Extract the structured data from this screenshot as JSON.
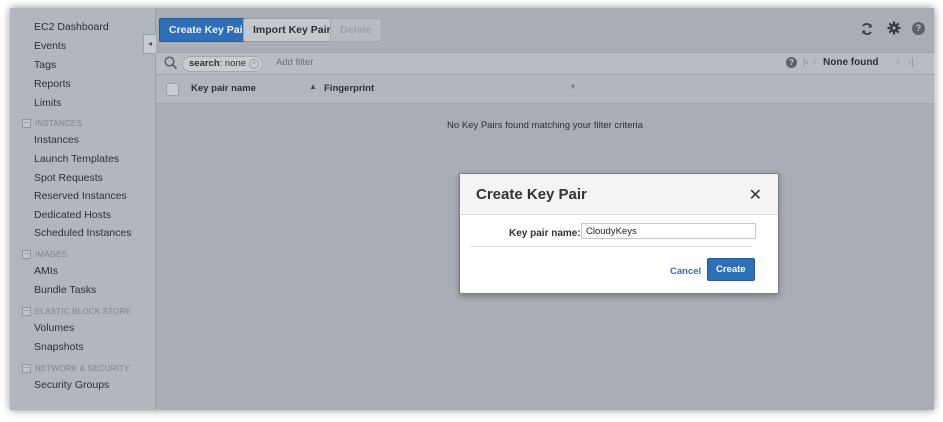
{
  "sidebar": {
    "items": [
      {
        "label": "EC2 Dashboard"
      },
      {
        "label": "Events"
      },
      {
        "label": "Tags"
      },
      {
        "label": "Reports"
      },
      {
        "label": "Limits"
      },
      {
        "label": "Instances"
      },
      {
        "label": "Launch Templates"
      },
      {
        "label": "Spot Requests"
      },
      {
        "label": "Reserved Instances"
      },
      {
        "label": "Dedicated Hosts"
      },
      {
        "label": "Scheduled Instances"
      },
      {
        "label": "AMIs"
      },
      {
        "label": "Bundle Tasks"
      },
      {
        "label": "Volumes"
      },
      {
        "label": "Snapshots"
      },
      {
        "label": "Security Groups"
      }
    ],
    "sections": [
      {
        "label": "INSTANCES"
      },
      {
        "label": "IMAGES"
      },
      {
        "label": "ELASTIC BLOCK STORE"
      },
      {
        "label": "NETWORK & SECURITY"
      }
    ],
    "collapse_glyph": "◂"
  },
  "toolbar": {
    "create_label": "Create Key Pair",
    "import_label": "Import Key Pair",
    "delete_label": "Delete",
    "icons": [
      "refresh-icon",
      "gear-icon",
      "help-icon"
    ]
  },
  "filter": {
    "chip_key": "search",
    "chip_value": ": none",
    "placeholder": "Add filter",
    "pager_label": "None found"
  },
  "table": {
    "columns": [
      "Key pair name",
      "Fingerprint"
    ],
    "empty_message": "No Key Pairs found matching your filter criteria"
  },
  "modal": {
    "title": "Create Key Pair",
    "field_label": "Key pair name:",
    "field_value": "CloudyKeys",
    "cancel_label": "Cancel",
    "create_label": "Create"
  }
}
